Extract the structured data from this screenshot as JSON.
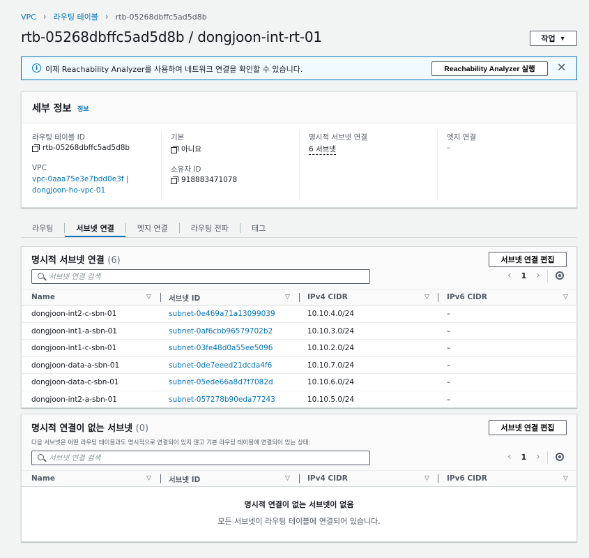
{
  "breadcrumb": {
    "root": "VPC",
    "parent": "라우팅 테이블",
    "current": "rtb-05268dbffc5ad5d8b"
  },
  "page": {
    "title": "rtb-05268dbffc5ad5d8b / dongjoon-int-rt-01",
    "action_label": "작업"
  },
  "banner": {
    "text": "이제 Reachability Analyzer를 사용하여 네트워크 연결을 확인할 수 있습니다.",
    "button": "Reachability Analyzer 실행"
  },
  "details": {
    "title": "세부 정보",
    "info": "정보",
    "rt_id_label": "라우팅 테이블 ID",
    "rt_id_value": "rtb-05268dbffc5ad5d8b",
    "vpc_label": "VPC",
    "vpc_value_1": "vpc-0aaa75e3e7bdd0e3f |",
    "vpc_value_2": "dongjoon-ho-vpc-01",
    "main_label": "기본",
    "main_value": "아니요",
    "owner_label": "소유자 ID",
    "owner_value": "918883471078",
    "explicit_label": "명시적 서브넷 연결",
    "explicit_value": "6 서브넷",
    "edge_label": "엣지 연결",
    "edge_value": "–"
  },
  "tabs": [
    "라우팅",
    "서브넷 연결",
    "엣지 연결",
    "라우팅 전파",
    "태그"
  ],
  "explicit": {
    "title": "명시적 서브넷 연결",
    "count": "(6)",
    "edit_button": "서브넷 연결 편집",
    "search_placeholder": "서브넷 연결 검색",
    "page": "1",
    "columns": [
      "Name",
      "서브넷 ID",
      "IPv4 CIDR",
      "IPv6 CIDR"
    ],
    "rows": [
      [
        "dongjoon-int2-c-sbn-01",
        "subnet-0e469a71a13099039",
        "10.10.4.0/24",
        "–"
      ],
      [
        "dongjoon-int1-a-sbn-01",
        "subnet-0af6cbb96579702b2",
        "10.10.3.0/24",
        "–"
      ],
      [
        "dongjoon-int1-c-sbn-01",
        "subnet-03fe48d0a55ee5096",
        "10.10.2.0/24",
        "–"
      ],
      [
        "dongjoon-data-a-sbn-01",
        "subnet-0de7eeed21dcda4f6",
        "10.10.7.0/24",
        "–"
      ],
      [
        "dongjoon-data-c-sbn-01",
        "subnet-05ede66a8d7f7082d",
        "10.10.6.0/24",
        "–"
      ],
      [
        "dongjoon-int2-a-sbn-01",
        "subnet-057278b90eda77243",
        "10.10.5.0/24",
        "–"
      ]
    ]
  },
  "unassoc": {
    "title": "명시적 연결이 없는 서브넷",
    "count": "(0)",
    "edit_button": "서브넷 연결 편집",
    "description": "다음 서브넷은 어떤 라우팅 테이블과도 명시적으로 연결되어 있지 않고 기본 라우팅 테이블에 연결되어 있는 상태:",
    "search_placeholder": "서브넷 연결 검색",
    "page": "1",
    "columns": [
      "Name",
      "서브넷 ID",
      "IPv4 CIDR",
      "IPv6 CIDR"
    ],
    "empty_title": "명시적 연결이 없는 서브넷이 없음",
    "empty_sub": "모든 서브넷이 라우팅 테이블에 연결되어 있습니다."
  },
  "colors": {
    "link": "#0073bb",
    "text": "#16191f",
    "muted": "#545b64",
    "background": "#f2f3f3"
  }
}
